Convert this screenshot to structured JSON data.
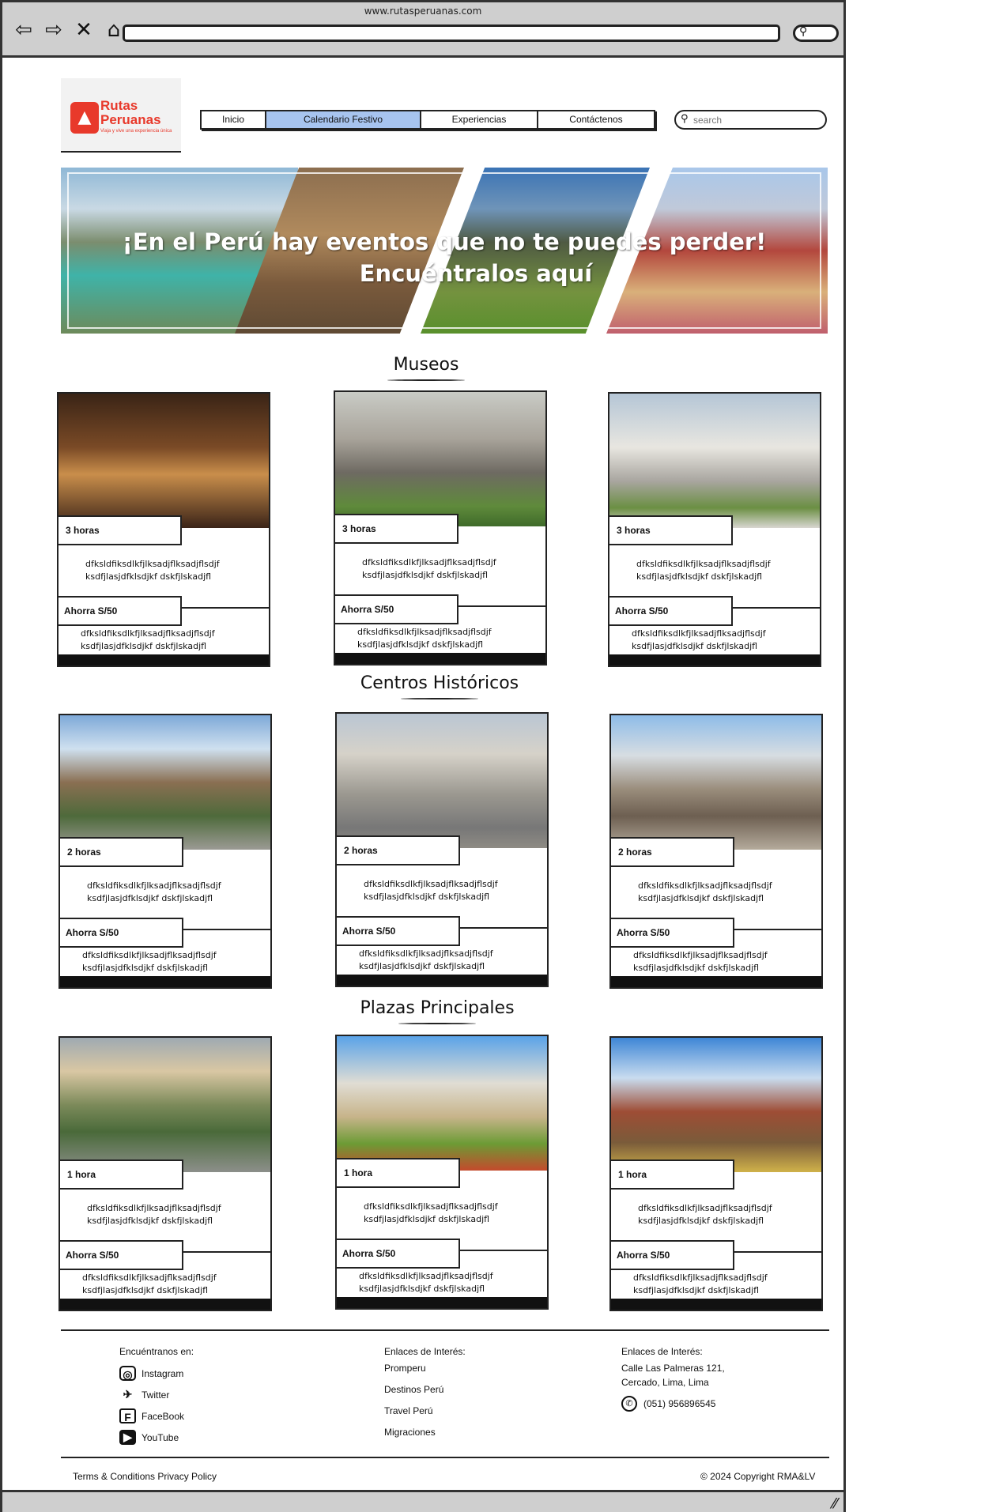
{
  "browser": {
    "url": "www.rutasperuanas.com",
    "nav_icons": [
      "back-arrow-icon",
      "forward-arrow-icon",
      "close-x-icon",
      "home-icon"
    ]
  },
  "logo": {
    "title_line1": "Rutas",
    "title_line2": "Peruanas",
    "tagline": "Viaja y vive una experiencia única"
  },
  "menu": [
    "Inicio",
    "Calendario Festivo",
    "Experiencias",
    "Contáctenos"
  ],
  "search": {
    "placeholder": "search"
  },
  "hero": {
    "line1": "¡En el Perú hay eventos que no te puedes perder!",
    "line2": "Encuéntralos aquí"
  },
  "sections": [
    {
      "title": "Museos",
      "cards": [
        {
          "duration": "3 horas",
          "desc": "dfksldfiksdlkfjlksadjflksadjflsdjf ksdfjlasjdfklsdjkf dskfjlskadjfl",
          "price": "Ahorra S/50",
          "desc2": "dfksldfiksdlkfjlksadjflksadjflsdjf ksdfjlasjdfklsdjkf dskfjlskadjfl"
        },
        {
          "duration": "3 horas",
          "desc": "dfksldfiksdlkfjlksadjflksadjflsdjf ksdfjlasjdfklsdjkf dskfjlskadjfl",
          "price": "Ahorra S/50",
          "desc2": "dfksldfiksdlkfjlksadjflksadjflsdjf ksdfjlasjdfklsdjkf dskfjlskadjfl"
        },
        {
          "duration": "3 horas",
          "desc": "dfksldfiksdlkfjlksadjflksadjflsdjf ksdfjlasjdfklsdjkf dskfjlskadjfl",
          "price": "Ahorra S/50",
          "desc2": "dfksldfiksdlkfjlksadjflksadjflsdjf ksdfjlasjdfklsdjkf dskfjlskadjfl"
        }
      ]
    },
    {
      "title": "Centros Históricos",
      "cards": [
        {
          "duration": "2 horas",
          "desc": "dfksldfiksdlkfjlksadjflksadjflsdjf ksdfjlasjdfklsdjkf dskfjlskadjfl",
          "price": "Ahorra S/50",
          "desc2": "dfksldfiksdlkfjlksadjflksadjflsdjf ksdfjlasjdfklsdjkf dskfjlskadjfl"
        },
        {
          "duration": "2 horas",
          "desc": "dfksldfiksdlkfjlksadjflksadjflsdjf ksdfjlasjdfklsdjkf dskfjlskadjfl",
          "price": "Ahorra S/50",
          "desc2": "dfksldfiksdlkfjlksadjflksadjflsdjf ksdfjlasjdfklsdjkf dskfjlskadjfl"
        },
        {
          "duration": "2 horas",
          "desc": "dfksldfiksdlkfjlksadjflksadjflsdjf ksdfjlasjdfklsdjkf dskfjlskadjfl",
          "price": "Ahorra S/50",
          "desc2": "dfksldfiksdlkfjlksadjflksadjflsdjf ksdfjlasjdfklsdjkf dskfjlskadjfl"
        }
      ]
    },
    {
      "title": "Plazas Principales",
      "cards": [
        {
          "duration": "1 hora",
          "desc": "dfksldfiksdlkfjlksadjflksadjflsdjf ksdfjlasjdfklsdjkf dskfjlskadjfl",
          "price": "Ahorra S/50",
          "desc2": "dfksldfiksdlkfjlksadjflksadjflsdjf ksdfjlasjdfklsdjkf dskfjlskadjfl"
        },
        {
          "duration": "1 hora",
          "desc": "dfksldfiksdlkfjlksadjflksadjflsdjf ksdfjlasjdfklsdjkf dskfjlskadjfl",
          "price": "Ahorra S/50",
          "desc2": "dfksldfiksdlkfjlksadjflksadjflsdjf ksdfjlasjdfklsdjkf dskfjlskadjfl"
        },
        {
          "duration": "1 hora",
          "desc": "dfksldfiksdlkfjlksadjflksadjflsdjf ksdfjlasjdfklsdjkf dskfjlskadjfl",
          "price": "Ahorra S/50",
          "desc2": "dfksldfiksdlkfjlksadjflksadjflsdjf ksdfjlasjdfklsdjkf dskfjlskadjfl"
        }
      ]
    }
  ],
  "footer": {
    "col1": {
      "title": "Encuéntranos en:",
      "items": [
        {
          "label": "Instagram",
          "icon": "instagram-icon"
        },
        {
          "label": "Twitter",
          "icon": "twitter-icon"
        },
        {
          "label": "FaceBook",
          "icon": "facebook-icon"
        },
        {
          "label": "YouTube",
          "icon": "youtube-icon"
        }
      ]
    },
    "col2": {
      "title": "Enlaces de Interés:",
      "links": [
        "Promperu",
        "Destinos Perú",
        "Travel Perú",
        "Migraciones"
      ]
    },
    "col3": {
      "title": "Enlaces de Interés:",
      "address_line1": "Calle Las Palmeras 121,",
      "address_line2": "Cercado, Lima, Lima",
      "phone": "(051) 956896545",
      "phone_icon": "whatsapp-icon"
    },
    "legal": "Terms & Conditions Privacy Policy",
    "copyright": "© 2024 Copyright RMA&LV"
  }
}
